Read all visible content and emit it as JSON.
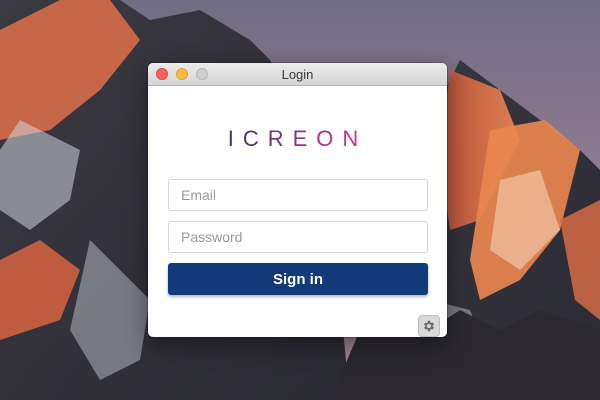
{
  "window": {
    "title": "Login"
  },
  "logo": {
    "text": "ICREON",
    "colors": [
      "#3d3577",
      "#e0338f"
    ]
  },
  "form": {
    "email_placeholder": "Email",
    "password_placeholder": "Password",
    "signin_label": "Sign in"
  },
  "settings": {
    "icon": "gear-icon"
  },
  "colors": {
    "button": "#123a79",
    "close": "#fc605c",
    "minimize": "#fdbc40",
    "zoom_disabled": "#cfcfcf"
  }
}
